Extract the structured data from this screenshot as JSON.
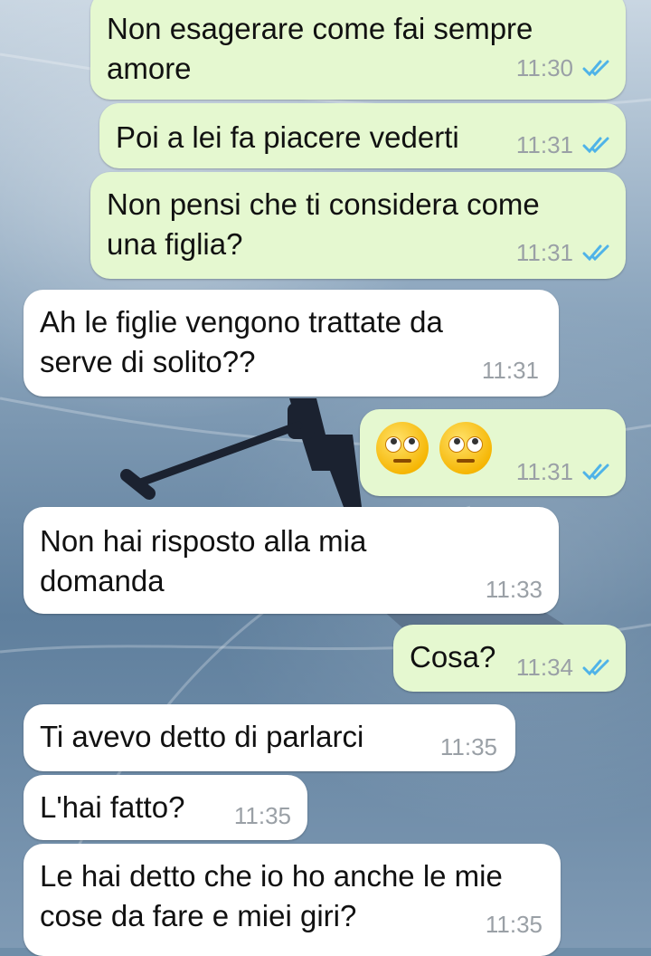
{
  "chat": {
    "messages": [
      {
        "direction": "out",
        "text": "Non esagerare come fai sempre\namore",
        "time": "11:30",
        "read": true
      },
      {
        "direction": "out",
        "text": "Poi a lei fa piacere vederti",
        "time": "11:31",
        "read": true
      },
      {
        "direction": "out",
        "text": "Non pensi che ti considera come\nuna figlia?",
        "time": "11:31",
        "read": true
      },
      {
        "direction": "in",
        "text": "Ah le figlie vengono trattate da\nserve di solito??",
        "time": "11:31"
      },
      {
        "direction": "out",
        "emoji": "face-with-rolling-eyes x2",
        "time": "11:31",
        "read": true
      },
      {
        "direction": "in",
        "text": "Non hai risposto alla mia\ndomanda",
        "time": "11:33"
      },
      {
        "direction": "out",
        "text": "Cosa?",
        "time": "11:34",
        "read": true
      },
      {
        "direction": "in",
        "text": "Ti avevo detto di parlarci",
        "time": "11:35"
      },
      {
        "direction": "in",
        "text": "L'hai fatto?",
        "time": "11:35"
      },
      {
        "direction": "in",
        "text": "Le hai detto che io ho anche le mie\ncose da fare e miei giri?",
        "time": "11:35"
      }
    ]
  },
  "colors": {
    "outgoing_bubble": "#e5f8d0",
    "incoming_bubble": "#ffffff",
    "read_tick": "#4fb3e8",
    "timestamp": "#9aa0a6"
  },
  "icons": {
    "read_receipt": "double-check-icon",
    "emoji": "face-with-rolling-eyes"
  }
}
